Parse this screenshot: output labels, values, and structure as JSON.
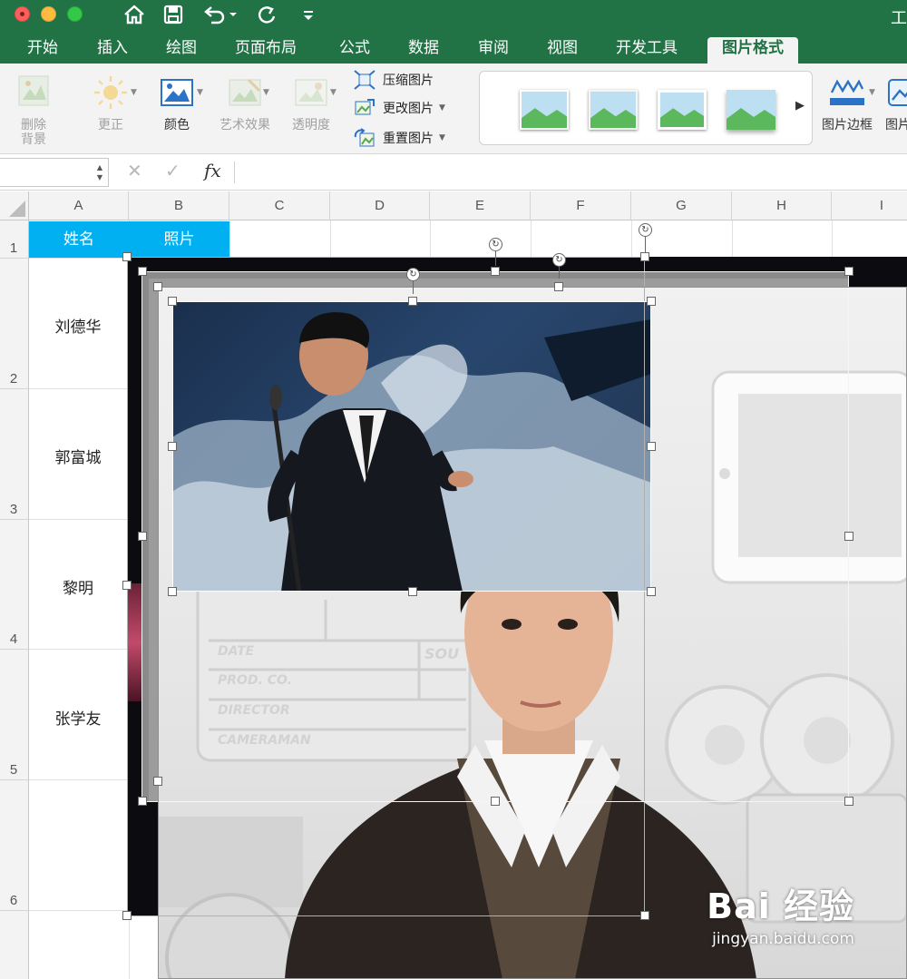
{
  "window": {
    "title": "工"
  },
  "quick_access": {
    "icons": [
      "home-icon",
      "save-icon",
      "undo-icon",
      "redo-icon",
      "customize-icon"
    ]
  },
  "tabs": [
    {
      "label": "开始"
    },
    {
      "label": "插入"
    },
    {
      "label": "绘图"
    },
    {
      "label": "页面布局"
    },
    {
      "label": "公式"
    },
    {
      "label": "数据"
    },
    {
      "label": "审阅"
    },
    {
      "label": "视图"
    },
    {
      "label": "开发工具"
    },
    {
      "label": "图片格式",
      "active": true
    }
  ],
  "ribbon": {
    "remove_bg_line1": "删除",
    "remove_bg_line2": "背景",
    "corrections": "更正",
    "color": "颜色",
    "artistic": "艺术效果",
    "transparency": "透明度",
    "compress": "压缩图片",
    "change": "更改图片",
    "reset": "重置图片",
    "border": "图片边框",
    "effects_partial": "图片"
  },
  "formula_bar": {
    "namebox_value": "",
    "cancel": "✕",
    "enter": "✓",
    "fx": "fx",
    "value": ""
  },
  "columns": [
    "A",
    "B",
    "C",
    "D",
    "E",
    "F",
    "G",
    "H",
    "I"
  ],
  "rows": [
    "1",
    "2",
    "3",
    "4",
    "5",
    "6"
  ],
  "header_row": {
    "name": "姓名",
    "photo": "照片"
  },
  "names": [
    "刘德华",
    "郭富城",
    "黎明",
    "张学友"
  ],
  "watermark": {
    "brand": "Bai 经验",
    "url": "jingyan.baidu.com"
  },
  "colors": {
    "excel_green": "#217346",
    "header_fill": "#00b0f0"
  }
}
